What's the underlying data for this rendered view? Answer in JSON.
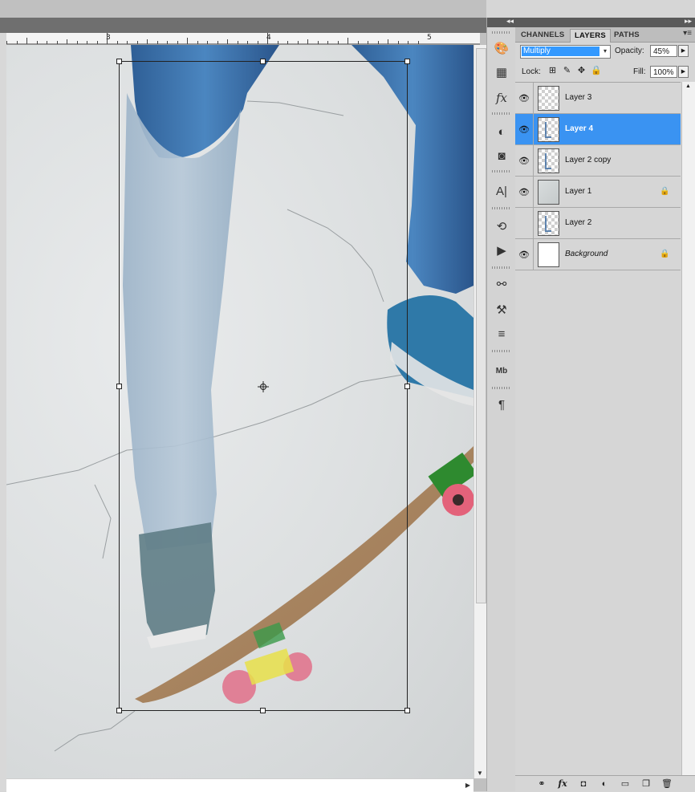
{
  "ruler": {
    "marks": [
      "3",
      "4",
      "5"
    ]
  },
  "dock": {
    "tools": [
      "brush-presets-icon",
      "swatches-grid-icon",
      "styles-fx-icon",
      "adjustments-icon",
      "masks-icon",
      "character-icon",
      "history-icon",
      "actions-play-icon",
      "clone-source-icon",
      "tool-presets-icon",
      "stamp-icon",
      "mini-bridge-icon",
      "paragraph-icon"
    ],
    "labels": {
      "styles": "fx",
      "character": "A|",
      "bridge": "Mb",
      "paragraph": "¶"
    }
  },
  "layers_panel": {
    "tabs": [
      "CHANNELS",
      "LAYERS",
      "PATHS"
    ],
    "active_tab": "LAYERS",
    "blend_mode": "Multiply",
    "opacity_label": "Opacity:",
    "opacity": "45%",
    "lock_label": "Lock:",
    "fill_label": "Fill:",
    "fill": "100%",
    "layers": [
      {
        "name": "Layer 3",
        "visible": true,
        "selected": false,
        "locked": false
      },
      {
        "name": "Layer 4",
        "visible": true,
        "selected": true,
        "locked": false
      },
      {
        "name": "Layer 2 copy",
        "visible": true,
        "selected": false,
        "locked": false
      },
      {
        "name": "Layer 1",
        "visible": true,
        "selected": false,
        "locked": true
      },
      {
        "name": "Layer 2",
        "visible": false,
        "selected": false,
        "locked": false
      },
      {
        "name": "Background",
        "visible": true,
        "selected": false,
        "locked": true
      }
    ],
    "footer_buttons": [
      "link-layers-icon",
      "add-layer-style-icon",
      "add-mask-icon",
      "new-adjustment-layer-icon",
      "new-group-icon",
      "new-layer-icon",
      "delete-layer-icon"
    ],
    "footer_labels": {
      "fx": "fx"
    }
  },
  "colors": {
    "selection": "#3a93f2",
    "blend_highlight": "#3399ff",
    "panel_bg": "#d6d6d6",
    "header_bg": "#5a5a5a"
  }
}
